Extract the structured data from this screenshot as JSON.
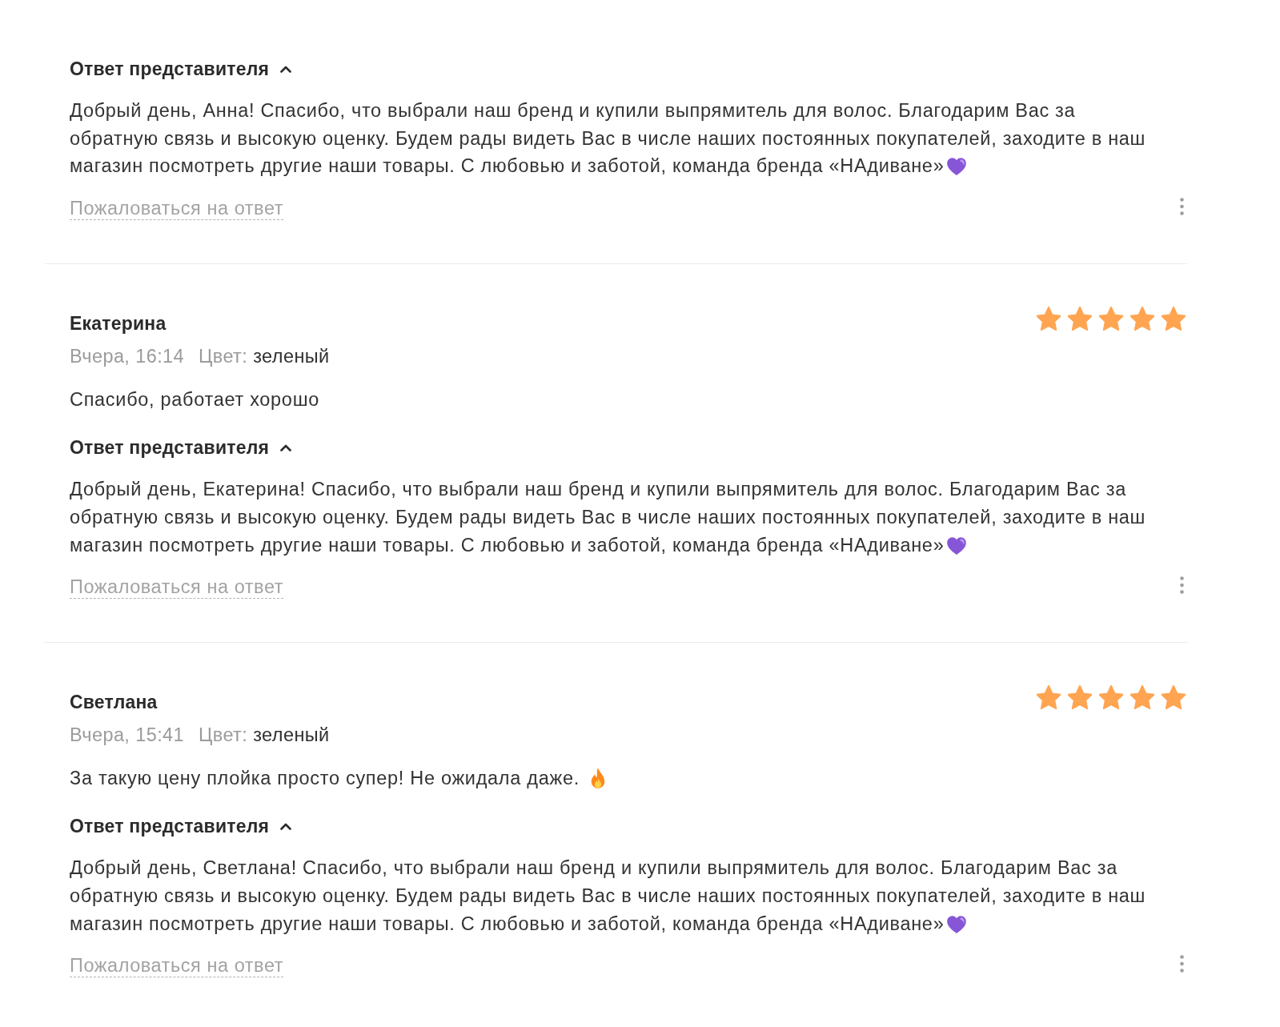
{
  "reviews": [
    {
      "reply": {
        "title": "Ответ представителя",
        "expanded": true,
        "kind": "with_heart",
        "text": "Добрый день, Анна! Спасибо, что выбрали наш бренд и купили выпрямитель для волос. Благодарим Вас за обратную связь и высокую оценку. Будем рады видеть Вас в числе наших постоянных покупателей, заходите в наш магазин посмотреть другие наши товары. С любовью и заботой, команда бренда «НАдиване»",
        "complaint_link": "Пожаловаться на ответ"
      }
    },
    {
      "author": "Екатерина",
      "stars": 5,
      "date": "Вчера, 16:14",
      "attribute_label": "Цвет:",
      "attribute_value": "зеленый",
      "comment": {
        "kind": "plain",
        "text": "Спасибо, работает хорошо"
      },
      "reply": {
        "title": "Ответ представителя",
        "expanded": true,
        "kind": "with_heart",
        "text": "Добрый день, Екатерина! Спасибо, что выбрали наш бренд и купили выпрямитель для волос. Благодарим Вас за обратную связь и высокую оценку. Будем рады видеть Вас в числе наших постоянных покупателей, заходите в наш магазин посмотреть другие наши товары. С любовью и заботой, команда бренда «НАдиване»",
        "complaint_link": "Пожаловаться на ответ"
      }
    },
    {
      "author": "Светлана",
      "stars": 5,
      "date": "Вчера, 15:41",
      "attribute_label": "Цвет:",
      "attribute_value": "зеленый",
      "comment": {
        "kind": "with_flame",
        "text": "За такую цену плойка просто супер! Не ожидала даже."
      },
      "reply": {
        "title": "Ответ представителя",
        "expanded": true,
        "kind": "with_heart",
        "text": "Добрый день, Светлана! Спасибо, что выбрали наш бренд и купили выпрямитель для волос. Благодарим Вас за обратную связь и высокую оценку. Будем рады видеть Вас в числе наших постоянных покупателей, заходите в наш магазин посмотреть другие наши товары. С любовью и заботой, команда бренда «НАдиване»",
        "complaint_link": "Пожаловаться на ответ"
      }
    }
  ]
}
